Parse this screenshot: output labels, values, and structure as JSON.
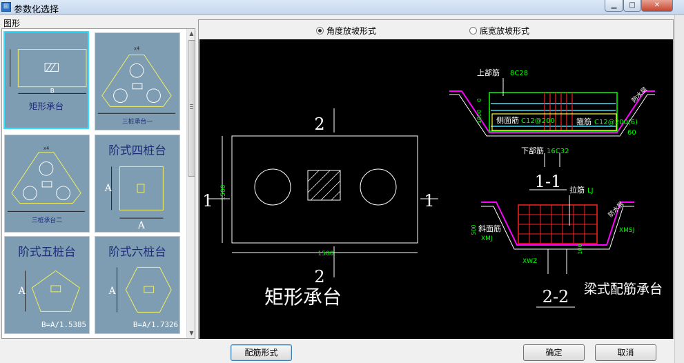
{
  "window": {
    "title": "参数化选择",
    "icon_glyph": "⊞",
    "controls": {
      "minimize": "▁",
      "maximize": "□",
      "close": "✕"
    }
  },
  "shapes_group": {
    "label": "图形",
    "items": [
      {
        "id": "rect",
        "label": "矩形承台",
        "dim_text": "B",
        "selected": true
      },
      {
        "id": "tri1",
        "label": "三桩承台一",
        "dim_text": "x4",
        "selected": false
      },
      {
        "id": "tri2",
        "label": "三桩承台二",
        "dim_text": "x4",
        "selected": false
      },
      {
        "id": "step4",
        "label": "阶式四桩台",
        "dim_text": "A",
        "selected": false
      },
      {
        "id": "step5",
        "label": "阶式五桩台",
        "dim_text": "A",
        "formula": "B=A/1.5385",
        "selected": false
      },
      {
        "id": "step6",
        "label": "阶式六桩台",
        "dim_text": "A",
        "formula": "B=A/1.7326",
        "selected": false
      }
    ]
  },
  "slope_mode": {
    "options": [
      {
        "label": "角度放坡形式",
        "selected": true
      },
      {
        "label": "底宽放坡形式",
        "selected": false
      }
    ]
  },
  "preview": {
    "plan": {
      "title": "矩形承台",
      "section_mark_top": "2",
      "section_mark_bottom": "2",
      "section_mark_left": "1",
      "section_mark_right": "1",
      "dim_width": "1500",
      "dim_height": "1500"
    },
    "section_1_1": {
      "name": "1-1",
      "top_bar_label": "上部筋",
      "top_bar_value": "8C28",
      "side_bar_label": "侧面筋",
      "side_bar_value": "C12@200",
      "stirrup_label": "箍筋",
      "stirrup_value": "C12@200(6)",
      "bottom_bar_label": "下部筋",
      "bottom_bar_value": "16C32",
      "angle": "60",
      "dim_left": "1000",
      "dim_zero": "0",
      "waterproof": "防水层"
    },
    "section_2_2": {
      "name": "2-2",
      "tie_label": "拉筋",
      "tie_value": "LJ",
      "slope_bar_label": "斜面筋",
      "xmj": "XMJ",
      "xmsj": "XMSJ",
      "xwz": "XWZ",
      "dim_left": "500",
      "dim_bottom": "100",
      "waterproof": "防水层",
      "title": "梁式配筋承台"
    }
  },
  "buttons": {
    "rebar_form": "配筋形式",
    "ok": "确定",
    "cancel": "取消"
  },
  "colors": {
    "canvas_bg": "#000000",
    "thumb_bg": "#7f9db2",
    "thumb_shape": "#f0f060",
    "cad_magenta": "#ff00ff",
    "cad_green": "#00ff00",
    "cad_red": "#ff2020",
    "cad_cyan": "#40e0ff",
    "cad_yellow": "#ffff40"
  }
}
